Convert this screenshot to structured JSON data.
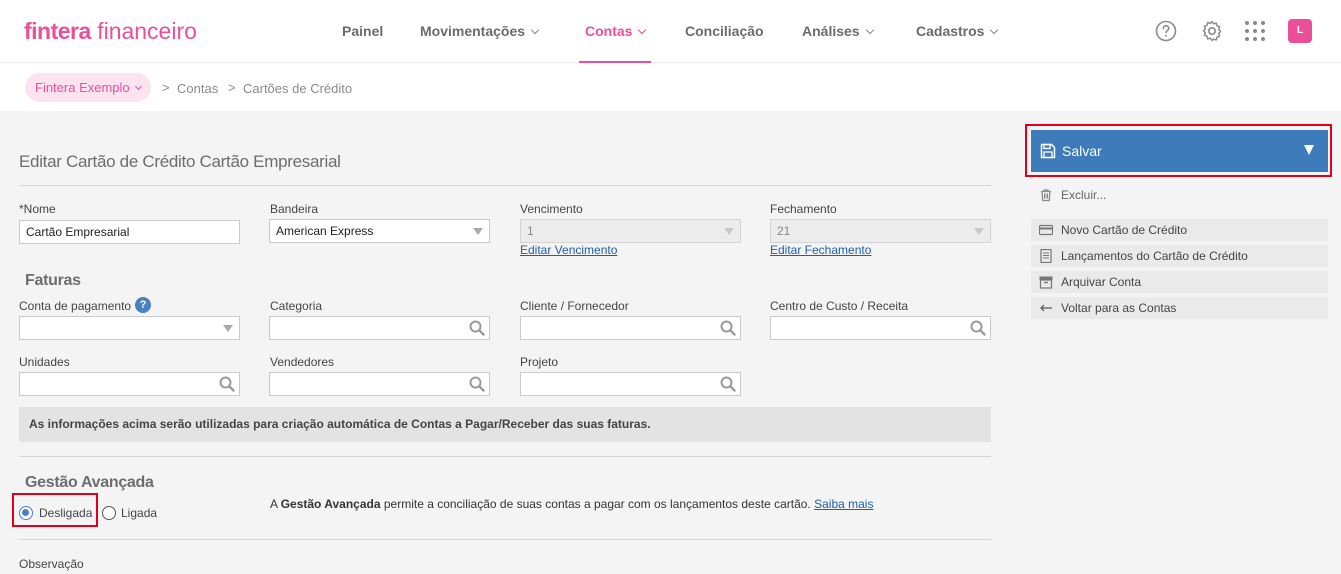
{
  "brand": {
    "name": "fintera",
    "product": "financeiro",
    "accent": "#ec4f9a"
  },
  "nav": {
    "items": [
      {
        "label": "Painel"
      },
      {
        "label": "Movimentações"
      },
      {
        "label": "Contas"
      },
      {
        "label": "Conciliação"
      },
      {
        "label": "Análises"
      },
      {
        "label": "Cadastros"
      }
    ],
    "active": "Contas",
    "icons": [
      "help-icon",
      "gear-icon",
      "apps-grid-icon"
    ],
    "avatar_letter": "L"
  },
  "breadcrumb": {
    "org": "Fintera Exemplo",
    "items": [
      "Contas",
      "Cartões de Crédito"
    ],
    "separator": ">"
  },
  "form": {
    "title": "Editar Cartão de Crédito Cartão Empresarial",
    "nome": {
      "label": "*Nome",
      "value": "Cartão Empresarial"
    },
    "bandeira": {
      "label": "Bandeira",
      "value": "American Express"
    },
    "vencimento": {
      "label": "Vencimento",
      "value": "1",
      "link": "Editar Vencimento"
    },
    "fechamento": {
      "label": "Fechamento",
      "value": "21",
      "link": "Editar Fechamento"
    },
    "faturas": {
      "title": "Faturas",
      "conta_pagamento": {
        "label": "Conta de pagamento",
        "value": ""
      },
      "categoria": {
        "label": "Categoria",
        "value": ""
      },
      "cliente_fornecedor": {
        "label": "Cliente / Fornecedor",
        "value": ""
      },
      "centro_custo": {
        "label": "Centro de Custo / Receita",
        "value": ""
      },
      "unidades": {
        "label": "Unidades",
        "value": ""
      },
      "vendedores": {
        "label": "Vendedores",
        "value": ""
      },
      "projeto": {
        "label": "Projeto",
        "value": ""
      },
      "info": "As informações acima serão utilizadas para criação automática de Contas a Pagar/Receber das suas faturas."
    },
    "gestao": {
      "title": "Gestão Avançada",
      "options": [
        "Desligada",
        "Ligada"
      ],
      "selected": "Desligada",
      "desc_prefix": "A ",
      "desc_bold": "Gestão Avançada",
      "desc_suffix": " permite a conciliação de suas contas a pagar com os lançamentos deste cartão.",
      "link": "Saiba mais"
    },
    "observacao": {
      "label": "Observação"
    }
  },
  "sidebar": {
    "save_label": "Salvar",
    "delete_label": "Excluir...",
    "actions": [
      {
        "label": "Novo Cartão de Crédito",
        "icon": "credit-card-icon"
      },
      {
        "label": "Lançamentos do Cartão de Crédito",
        "icon": "document-icon"
      },
      {
        "label": "Arquivar Conta",
        "icon": "archive-icon"
      },
      {
        "label": "Voltar para as Contas",
        "icon": "arrow-left-icon"
      }
    ]
  },
  "colors": {
    "primary_button": "#3e7bbb",
    "highlight": "#e0001b"
  }
}
